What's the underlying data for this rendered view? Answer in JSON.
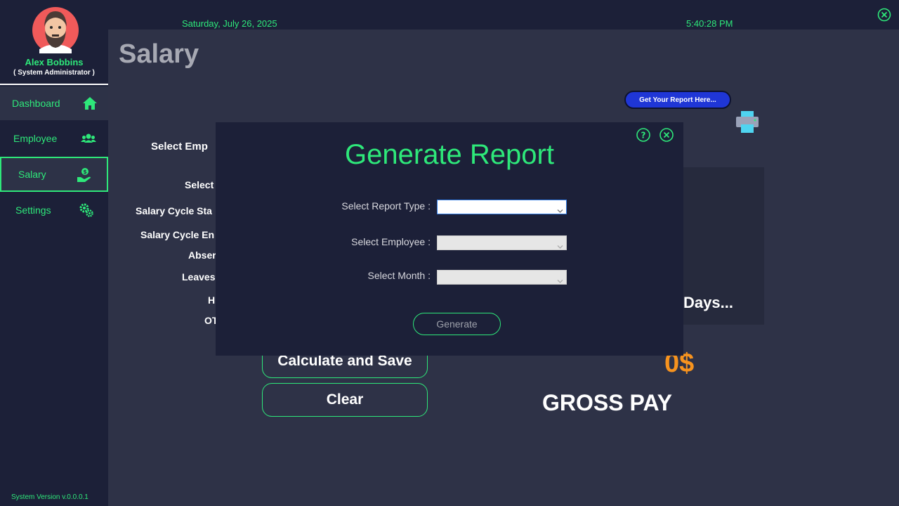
{
  "user": {
    "name": "Alex Bobbins",
    "role": "( System Administrator )"
  },
  "sidebar": {
    "items": [
      {
        "label": "Dashboard",
        "icon": "home-icon"
      },
      {
        "label": "Employee",
        "icon": "users-icon"
      },
      {
        "label": "Salary",
        "icon": "salary-hand-icon",
        "active": true
      },
      {
        "label": "Settings",
        "icon": "gears-icon"
      }
    ],
    "version": "System Version v.0.0.0.1"
  },
  "topbar": {
    "date": "Saturday, July 26, 2025",
    "time": "5:40:28 PM"
  },
  "page": {
    "title": "Salary",
    "report_bubble": "Get Your Report Here...",
    "labels": {
      "select_employee": "Select Emp",
      "select": "Select",
      "cycle_start": "Salary Cycle Sta",
      "cycle_end": "Salary Cycle En",
      "absent": "Abser",
      "leaves": "Leaves",
      "h": "H",
      "ot": "OT"
    },
    "days_text": "Days...",
    "calculate_button": "Calculate and Save",
    "clear_button": "Clear",
    "pay_value": "0$",
    "gross_label": "GROSS PAY"
  },
  "modal": {
    "title": "Generate Report",
    "fields": {
      "report_type_label": "Select Report Type :",
      "employee_label": "Select Employee :",
      "month_label": "Select Month :"
    },
    "generate_button": "Generate"
  },
  "colors": {
    "accent": "#2ee87a",
    "sidebar_bg": "#1c2038",
    "main_bg": "#2e3247",
    "pay_orange": "#f7931e",
    "bubble_blue": "#1f36d6"
  }
}
